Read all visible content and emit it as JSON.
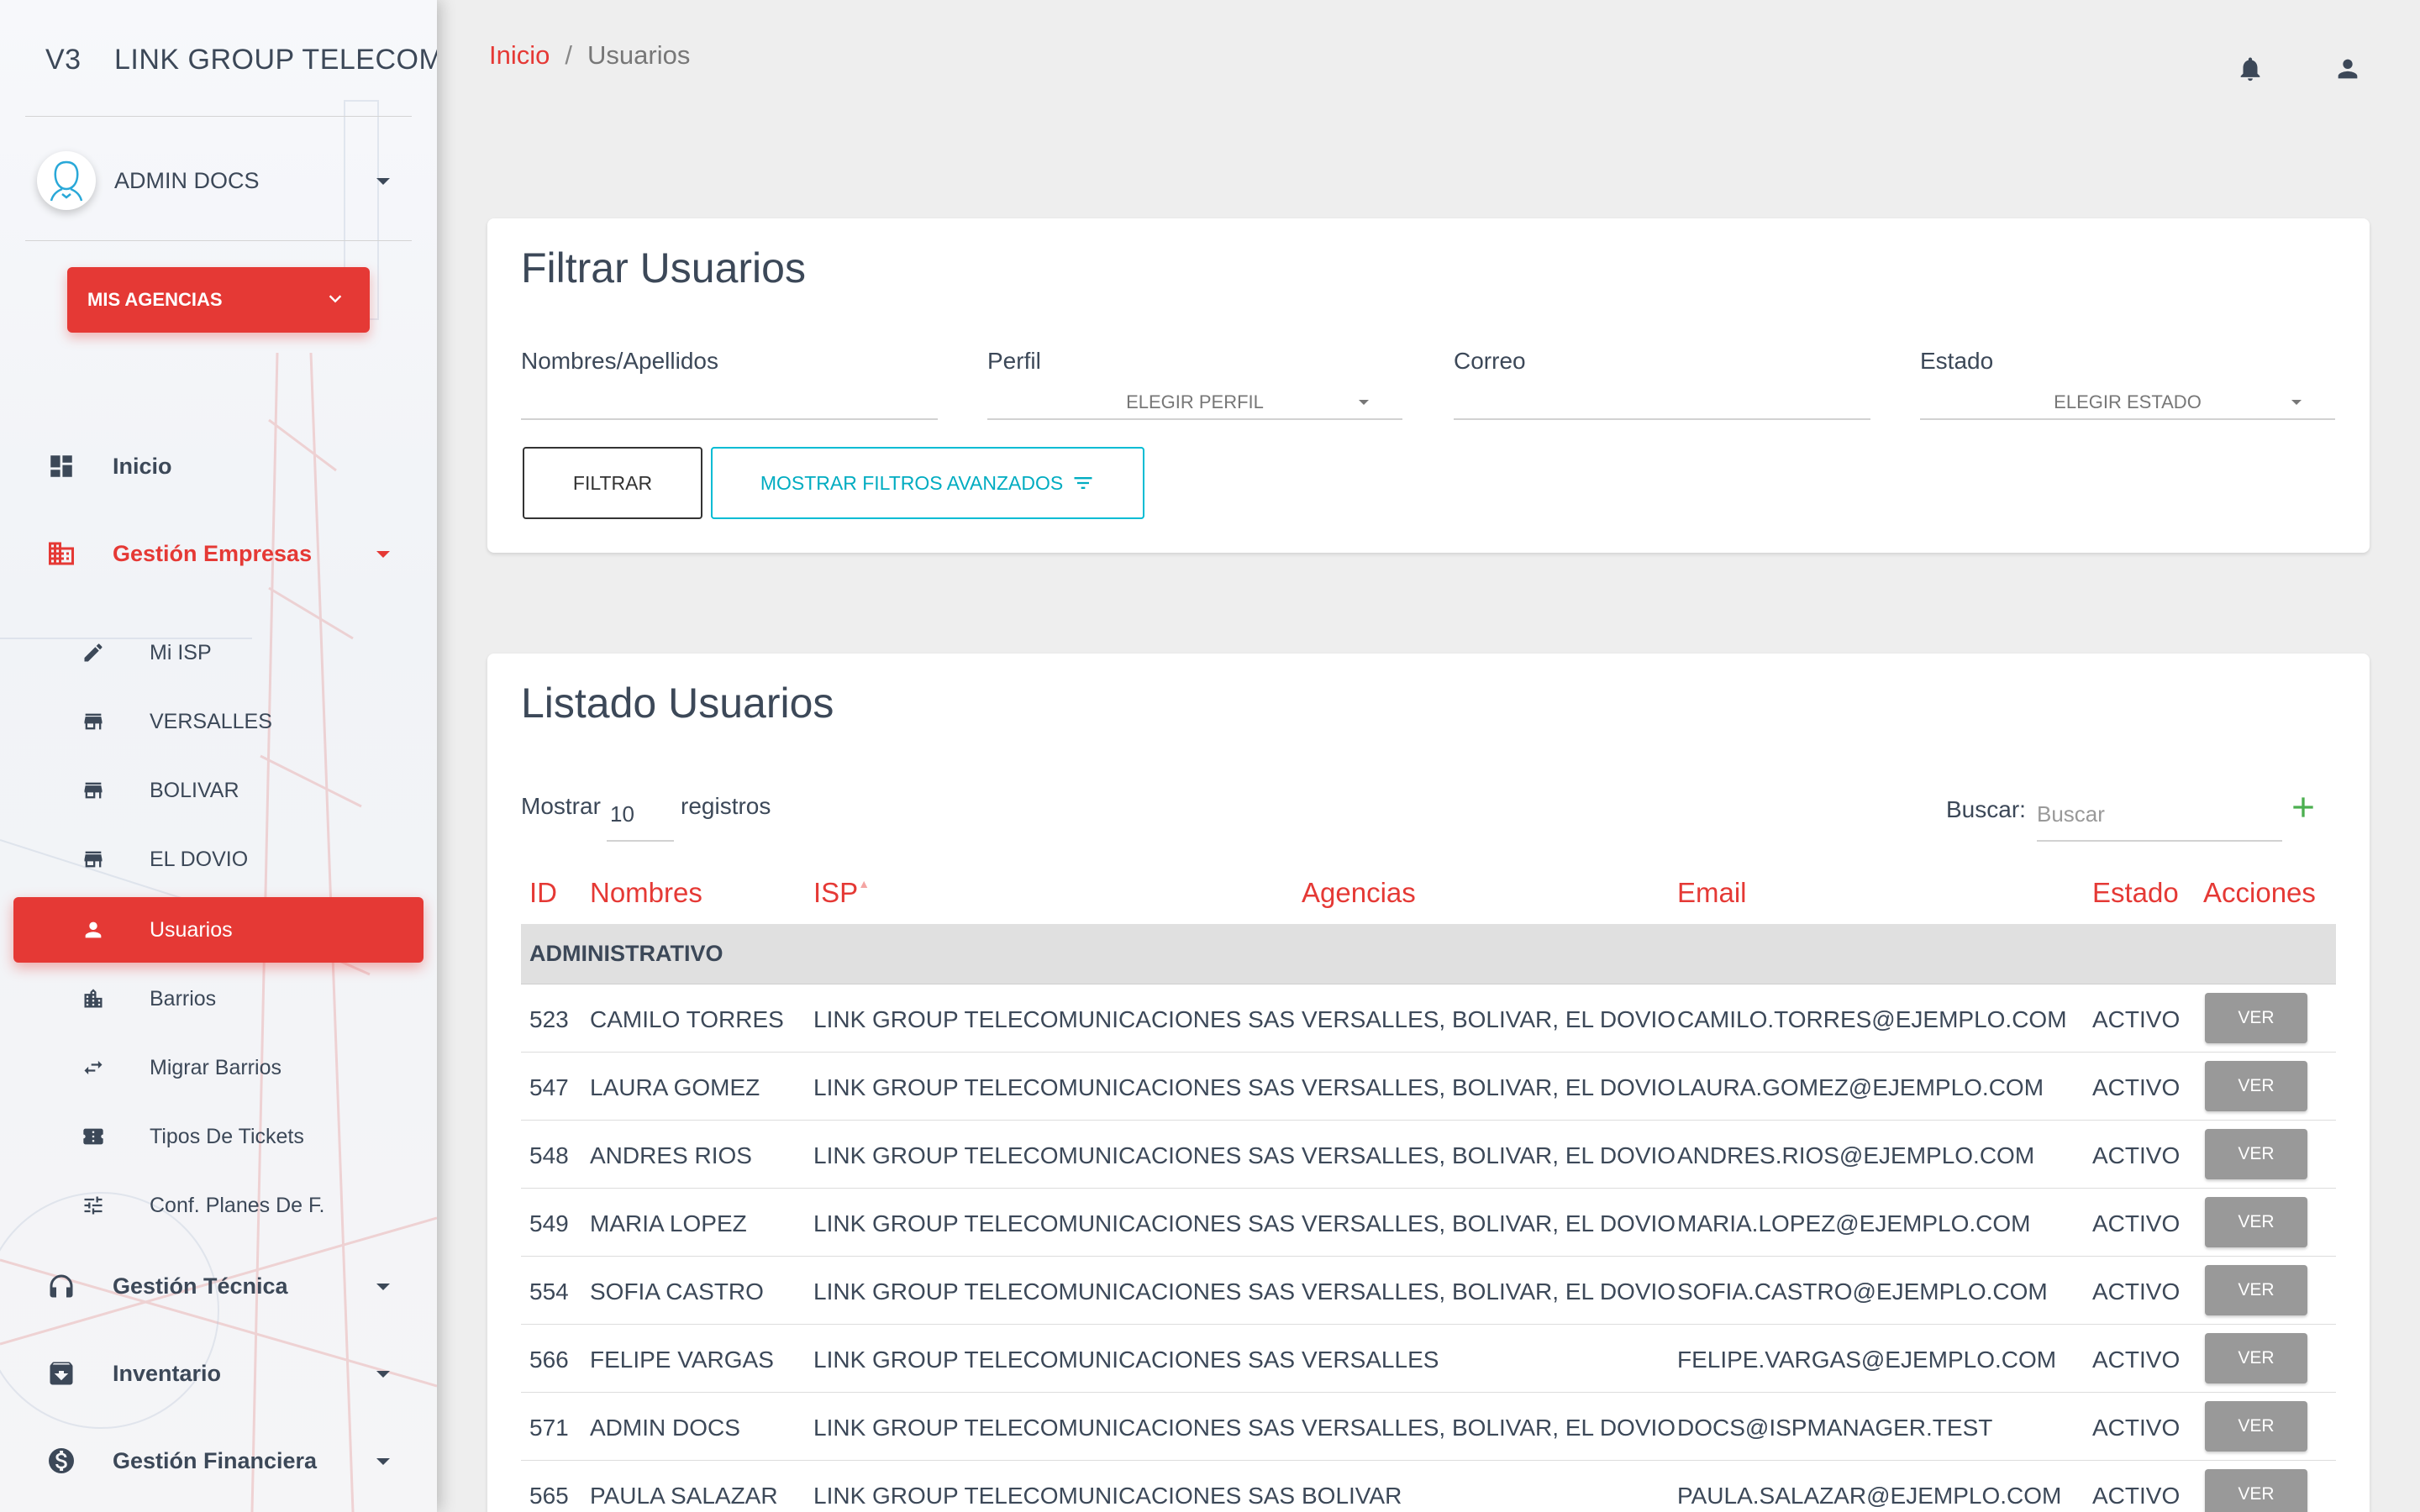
{
  "sidebar": {
    "logo_mini": "V3",
    "logo_text": "LINK GROUP TELECOMU",
    "user_name": "ADMIN DOCS",
    "agency_button": "MIS AGENCIAS",
    "nav": {
      "inicio": "Inicio",
      "gestion_empresas": "Gestión Empresas",
      "sub": {
        "mi_isp": "Mi ISP",
        "versalles": "VERSALLES",
        "bolivar": "BOLIVAR",
        "el_dovio": "EL DOVIO",
        "usuarios": "Usuarios",
        "barrios": "Barrios",
        "migrar_barrios": "Migrar Barrios",
        "tipos_tickets": "Tipos De Tickets",
        "conf_planes": "Conf. Planes De F."
      },
      "gestion_tecnica": "Gestión Técnica",
      "inventario": "Inventario",
      "gestion_financiera": "Gestión Financiera"
    }
  },
  "breadcrumb": {
    "home": "Inicio",
    "separator": "/",
    "current": "Usuarios"
  },
  "filter": {
    "title": "Filtrar Usuarios",
    "nombres_label": "Nombres/Apellidos",
    "perfil_label": "Perfil",
    "perfil_placeholder": "ELEGIR PERFIL",
    "correo_label": "Correo",
    "estado_label": "Estado",
    "estado_placeholder": "ELEGIR ESTADO",
    "filter_button": "FILTRAR",
    "advanced_button": "MOSTRAR FILTROS AVANZADOS"
  },
  "list": {
    "title": "Listado Usuarios",
    "show_label": "Mostrar",
    "show_value": "10",
    "show_suffix": "registros",
    "search_label": "Buscar:",
    "search_placeholder": "Buscar",
    "columns": {
      "id": "ID",
      "nombres": "Nombres",
      "isp": "ISP",
      "agencias": "Agencias",
      "email": "Email",
      "estado": "Estado",
      "acciones": "Acciones"
    },
    "group": "ADMINISTRATIVO",
    "action_label": "VER",
    "rows": [
      {
        "id": "523",
        "nombre": "CAMILO TORRES",
        "isp": "LINK GROUP TELECOMUNICACIONES SAS",
        "agencias": "VERSALLES, BOLIVAR, EL DOVIO",
        "email": "CAMILO.TORRES@EJEMPLO.COM",
        "estado": "ACTIVO"
      },
      {
        "id": "547",
        "nombre": "LAURA GOMEZ",
        "isp": "LINK GROUP TELECOMUNICACIONES SAS",
        "agencias": "VERSALLES, BOLIVAR, EL DOVIO",
        "email": "LAURA.GOMEZ@EJEMPLO.COM",
        "estado": "ACTIVO"
      },
      {
        "id": "548",
        "nombre": "ANDRES RIOS",
        "isp": "LINK GROUP TELECOMUNICACIONES SAS",
        "agencias": "VERSALLES, BOLIVAR, EL DOVIO",
        "email": "ANDRES.RIOS@EJEMPLO.COM",
        "estado": "ACTIVO"
      },
      {
        "id": "549",
        "nombre": "MARIA LOPEZ",
        "isp": "LINK GROUP TELECOMUNICACIONES SAS",
        "agencias": "VERSALLES, BOLIVAR, EL DOVIO",
        "email": "MARIA.LOPEZ@EJEMPLO.COM",
        "estado": "ACTIVO"
      },
      {
        "id": "554",
        "nombre": "SOFIA CASTRO",
        "isp": "LINK GROUP TELECOMUNICACIONES SAS",
        "agencias": "VERSALLES, BOLIVAR, EL DOVIO",
        "email": "SOFIA.CASTRO@EJEMPLO.COM",
        "estado": "ACTIVO"
      },
      {
        "id": "566",
        "nombre": "FELIPE VARGAS",
        "isp": "LINK GROUP TELECOMUNICACIONES SAS",
        "agencias": "VERSALLES",
        "email": "FELIPE.VARGAS@EJEMPLO.COM",
        "estado": "ACTIVO"
      },
      {
        "id": "571",
        "nombre": "ADMIN DOCS",
        "isp": "LINK GROUP TELECOMUNICACIONES SAS",
        "agencias": "VERSALLES, BOLIVAR, EL DOVIO",
        "email": "DOCS@ISPMANAGER.TEST",
        "estado": "ACTIVO"
      },
      {
        "id": "565",
        "nombre": "PAULA SALAZAR",
        "isp": "LINK GROUP TELECOMUNICACIONES SAS",
        "agencias": "BOLIVAR",
        "email": "PAULA.SALAZAR@EJEMPLO.COM",
        "estado": "ACTIVO"
      }
    ]
  },
  "colors": {
    "accent": "#e53935",
    "teal": "#00bcd4",
    "green": "#4caf50"
  }
}
